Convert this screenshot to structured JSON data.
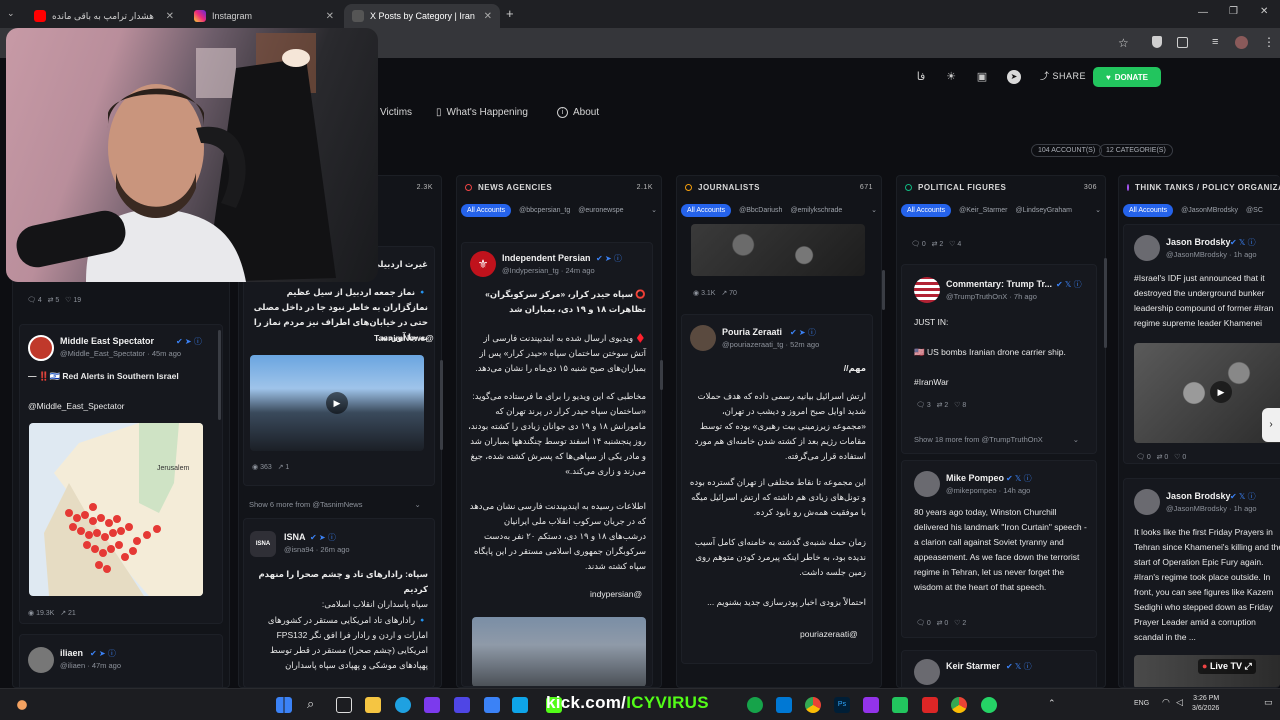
{
  "browser": {
    "tabs": [
      {
        "title": "هشدار ترامپ به باقی مانده",
        "favicon_color": "#ff0000"
      },
      {
        "title": "Instagram",
        "favicon_color": "#e1306c"
      },
      {
        "title": "X Posts by Category | Iran Mon",
        "favicon_color": "#888888"
      }
    ]
  },
  "site": {
    "lang_toggle": "فا",
    "share_label": "SHARE",
    "donate_label": "DONATE",
    "nav": [
      {
        "label": "Victims"
      },
      {
        "label": "What's Happening"
      },
      {
        "label": "About"
      }
    ],
    "accounts_pill": "104 ACCOUNT(S)",
    "categories_pill": "12 CATEGORIE(S)",
    "all_accounts_label": "All Accounts"
  },
  "columns": {
    "col1": {
      "count": "2.3K"
    },
    "news": {
      "title": "NEWS AGENCIES",
      "count": "2.1K",
      "accent": "#ef4444",
      "filters": [
        "@bbcpersian_tg",
        "@euronewspe"
      ]
    },
    "journalists": {
      "title": "JOURNALISTS",
      "count": "671",
      "accent": "#f59e0b",
      "filters": [
        "@BbcDariush",
        "@emilykschrade"
      ]
    },
    "political": {
      "title": "POLITICAL FIGURES",
      "count": "306",
      "accent": "#10b981",
      "filters": [
        "@Keir_Starmer",
        "@LindseyGraham"
      ]
    },
    "think": {
      "title": "THINK TANKS / POLICY ORGANIZA",
      "accent": "#a855f7",
      "filters": [
        "@JasonMBrodsky",
        "@SC"
      ]
    }
  },
  "posts": {
    "c1_top_stats": {
      "replies": "4",
      "reposts": "5",
      "likes": "19"
    },
    "c1_mes": {
      "name": "Middle East Spectator",
      "handle": "@Middle_East_Spectator",
      "time": "45m ago",
      "text1": "— ‼️🇮🇱 Red Alerts in Southern Israel",
      "text2": "@Middle_East_Spectator",
      "map_label": "Jerusalem",
      "views": "19.3K",
      "shares": "21"
    },
    "c1_ilia": {
      "name": "iliaen",
      "handle": "@iliaen",
      "time": "47m ago"
    },
    "c2_tasnim": {
      "title": "غیرت اردبیلی",
      "text": "🔹 نماز جمعه اردبیل از سیل عظیم نمازگزاران به خاطر نبود جا در داخل مصلی حتی در خیابان‌های اطراف نیز مردم نماز را به جا آوردند.",
      "sig": "TasnimNews@",
      "views": "363",
      "shares": "1",
      "more": "Show 6 more from @TasnimNews"
    },
    "c2_isna": {
      "name": "ISNA",
      "handle": "@isna94",
      "time": "26m ago",
      "avatar_label": "ISNA",
      "text1": "سپاه: رادارهای تاد و چشم صحرا را منهدم کردیم",
      "text2": "سپاه پاسداران انقلاب اسلامی:",
      "text3": "🔹 رادارهای تاد امریکایی مستقر در کشورهای امارات و اردن و رادار فرا افق نگر FPS132 امریکایی (چشم صحرا) مستقر در قطر توسط پهپادهای موشکی و پهپادی سپاه پاسداران"
    },
    "c3_ip": {
      "name": "Independent Persian",
      "handle": "@Indypersian_tg",
      "time": "24m ago",
      "text1": "⭕️ سپاه حیدر کرار، «مرکز سرکوبگران» تظاهرات ۱۸ و ۱۹ دی، بمباران شد",
      "text2": "♦️ ویدیوی ارسال شده به ایندیپندنت فارسی از آتش سوختن ساختمان سپاه «حیدر کرار» پس از بمباران‌های صبح شنبه ۱۵ دی‌ماه را نشان می‌دهد.",
      "text3": "مخاطبی که این ویدیو را برای ما فرستاده می‌گوید: «ساختمان سپاه حیدر کرار در پرند تهران که مامورانش ۱۸ و ۱۹ دی جوانان زیادی را کشته بودند، روز پنجشنبه ۱۴ اسفند توسط چنگندهها بمباران شد و مادر یکی از سپاهی‌ها که پسرش کشته شده، جیغ می‌زند و زاری می‌کند.»",
      "text4": "اطلاعات رسیده به ایندیپندنت فارسی نشان می‌دهد که در جریان سرکوب انقلاب ملی ایرانیان درشب‌های ۱۸ و ۱۹ دی، دستکم ۲۰ نفر به‌دست سرکوبگران جمهوری اسلامی مستقر در این پایگاه سپاه کشته شدند.",
      "sig": "indypersian@"
    },
    "c4_top_stats": {
      "views": "3.1K",
      "shares": "70"
    },
    "c4_pz": {
      "name": "Pouria Zeraati",
      "handle": "@pouriazeraati_tg",
      "time": "52m ago",
      "text1": "مهم//",
      "text2": "ارتش اسرائیل بیانیه رسمی داده که هدف حملات شدید اوایل صبح امروز و دیشب در تهران، «مجموعه زیرزمینی بیت رهبری» بوده که توسط مقامات رژیم بعد از کشته شدن خامنه‌ای هم مورد استفاده قرار می‌گرفته.",
      "text3": "این مجموعه تا نقاط مختلفی از تهران گسترده بوده و تونل‌های زیادی هم داشته که ارتش اسرائیل میگه با موفقیت همه‌ش رو نابود کرده.",
      "text4": "زمان حمله شنبه‌ی گذشته به خامنه‌ای کامل آسیب ندیده بود، به خاطر اینکه پیرمرد کودن متوهم روی زمین جلسه داشت.",
      "text5": "احتمالاً بزودی اخبار پودرسازی جدید بشنویم ...",
      "sig": "pouriazeraati@"
    },
    "c5_top_stats": {
      "replies": "0",
      "reposts": "2",
      "likes": "4"
    },
    "c5_trump": {
      "name": "Commentary: Trump Tr...",
      "handle": "@TrumpTruthOnX",
      "time": "7h ago",
      "text1": "JUST IN:",
      "text2": "🇺🇸 US bombs Iranian drone carrier ship.",
      "text3": "#IranWar",
      "replies": "3",
      "reposts": "2",
      "likes": "8",
      "more": "Show 18 more from @TrumpTruthOnX"
    },
    "c5_pompeo": {
      "name": "Mike Pompeo",
      "handle": "@mikepompeo",
      "time": "14h ago",
      "text": "80 years ago today, Winston Churchill delivered his landmark \"Iron Curtain\" speech - a clarion call against Soviet tyranny and appeasement.  As we face down the terrorist regime in Tehran, let us never forget the wisdom at the heart of that speech.",
      "replies": "0",
      "reposts": "0",
      "likes": "2"
    },
    "c5_keir": {
      "name": "Keir Starmer"
    },
    "c6_jb1": {
      "name": "Jason Brodsky",
      "handle": "@JasonMBrodsky",
      "time": "1h ago",
      "text": "#Israel's IDF just announced that it destroyed the underground bunker leadership compound of former #Iran regime supreme leader Khamenei",
      "replies": "0",
      "reposts": "0",
      "likes": "0"
    },
    "c6_jb2": {
      "name": "Jason Brodsky",
      "handle": "@JasonMBrodsky",
      "time": "1h ago",
      "text": "It looks like the first Friday Prayers in Tehran since Khamenei's killing and the start of Operation Epic Fury again. #Iran's regime took place outside. In front, you can see figures like Kazem Sedighi who stepped down as Friday Prayer Leader amid a corruption scandal in the ...",
      "live_label": "Live TV"
    }
  },
  "overlay": {
    "stream_text_a": "kick.com/",
    "stream_text_b": "ICYVIRUS"
  },
  "taskbar": {
    "lang": "ENG",
    "time": "3:26 PM",
    "date": "3/6/2026"
  }
}
